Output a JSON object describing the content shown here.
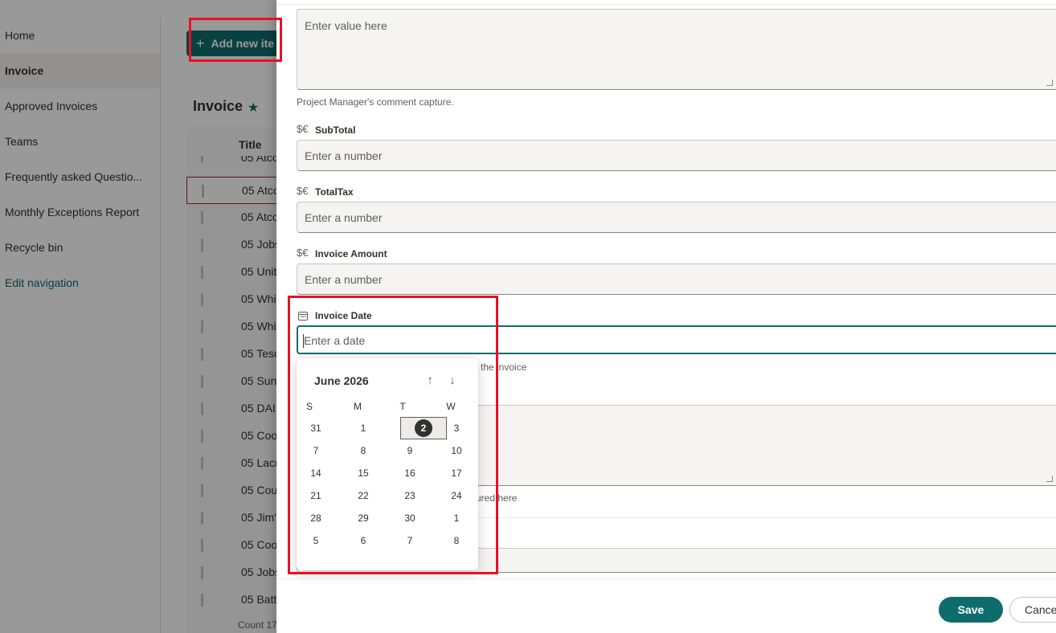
{
  "sidebar": {
    "items": [
      {
        "label": "Home"
      },
      {
        "label": "Invoice"
      },
      {
        "label": "Approved Invoices"
      },
      {
        "label": "Teams"
      },
      {
        "label": "Frequently asked Questio..."
      },
      {
        "label": "Monthly Exceptions Report"
      },
      {
        "label": "Recycle bin"
      },
      {
        "label": "Edit navigation"
      }
    ]
  },
  "main": {
    "add_label": "Add new ite",
    "add_icon": "+",
    "list_title": "Invoice",
    "star_icon": "★",
    "column_title": "Title",
    "rows": [
      "05 Atco",
      "05 Atco",
      "05 Atco",
      "05 Jobs",
      "05 Unit",
      "05 Whi",
      "05 Whi",
      "05 Tesc",
      "05 Sunl",
      "05 DAI",
      "05 Coo",
      "05 Lacr",
      "05 Cou",
      "05 Jim's",
      "05 Coo",
      "05 Jobs",
      "05 Batt"
    ],
    "count_label": "Count",
    "count_value": "17"
  },
  "panel": {
    "comment_placeholder": "Enter value here",
    "comment_help": "Project Manager's comment capture.",
    "currency_icon": "$€",
    "subtotal_label": "SubTotal",
    "subtotal_placeholder": "Enter a number",
    "totaltax_label": "TotalTax",
    "totaltax_placeholder": "Enter a number",
    "amount_label": "Invoice Amount",
    "amount_placeholder": "Enter a number",
    "date_label": "Invoice Date",
    "date_placeholder": "Enter a date",
    "date_help_partial": "the invoice",
    "notes_help_partial": "ured here",
    "save_label": "Save",
    "cancel_label": "Cance"
  },
  "datepicker": {
    "month": "June 2026",
    "up_icon": "↑",
    "down_icon": "↓",
    "weekdays": [
      "S",
      "M",
      "T",
      "W"
    ],
    "weeks": [
      [
        "31",
        "1",
        "2",
        "3"
      ],
      [
        "7",
        "8",
        "9",
        "10"
      ],
      [
        "14",
        "15",
        "16",
        "17"
      ],
      [
        "21",
        "22",
        "23",
        "24"
      ],
      [
        "28",
        "29",
        "30",
        "1"
      ],
      [
        "5",
        "6",
        "7",
        "8"
      ]
    ],
    "today": "2"
  }
}
